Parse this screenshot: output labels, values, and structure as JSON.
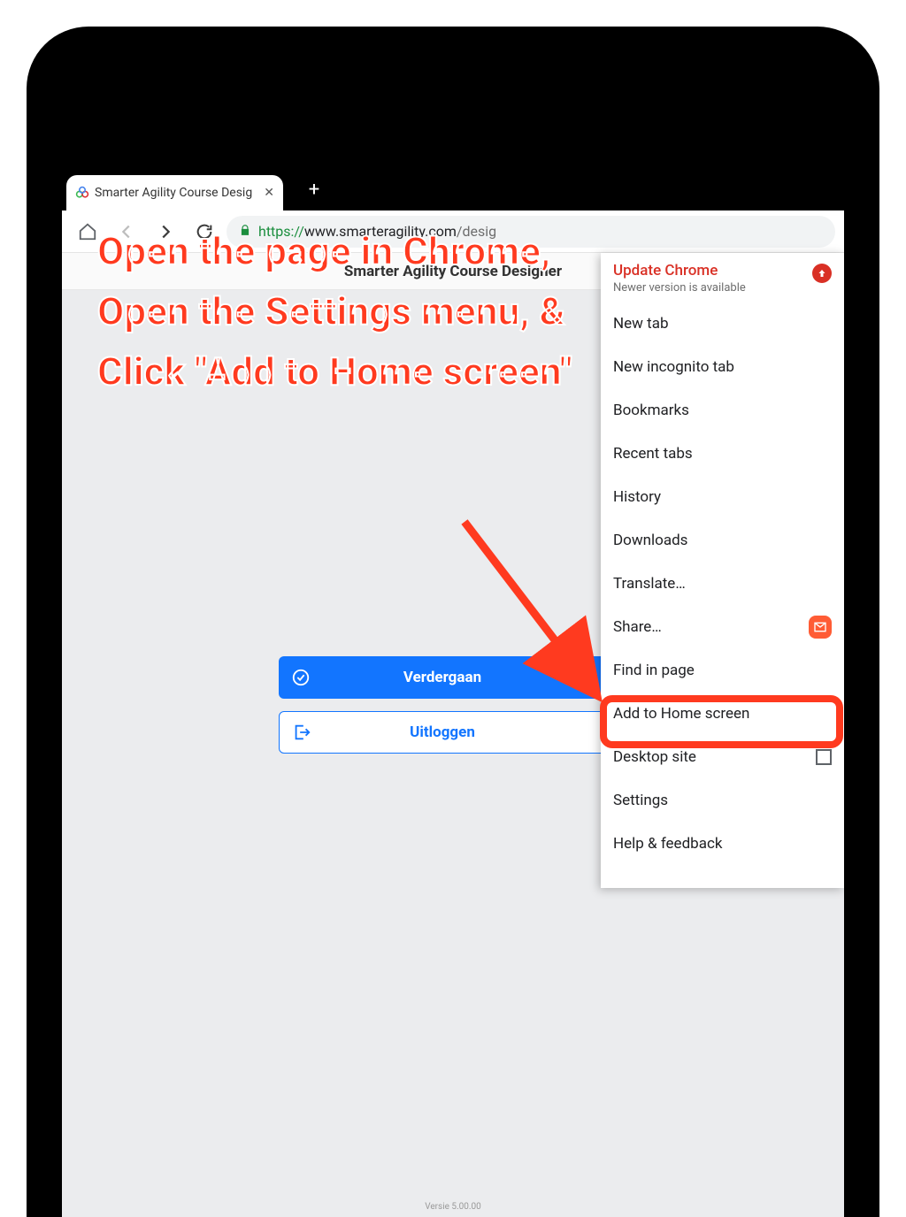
{
  "browser": {
    "tab_title": "Smarter Agility Course Desig",
    "url_scheme": "https://",
    "url_host": "www.smarteragility.com",
    "url_path": "/desig",
    "new_tab_plus": "+"
  },
  "page": {
    "title": "Smarter Agility Course Designer",
    "primary_label": "Verdergaan",
    "secondary_label": "Uitloggen",
    "version": "Versie 5.00.00"
  },
  "menu": {
    "update_title": "Update Chrome",
    "update_sub": "Newer version is available",
    "items": {
      "new_tab": "New tab",
      "new_incognito": "New incognito tab",
      "bookmarks": "Bookmarks",
      "recent_tabs": "Recent tabs",
      "history": "History",
      "downloads": "Downloads",
      "translate": "Translate…",
      "share": "Share…",
      "find_in_page": "Find in page",
      "add_to_home": "Add to Home screen",
      "desktop_site": "Desktop site",
      "settings": "Settings",
      "help": "Help & feedback"
    }
  },
  "annotation": {
    "line1": "Open the page in  Chrome,",
    "line2": "Open the Settings menu, &",
    "line3": "Click \"Add to Home screen\""
  }
}
